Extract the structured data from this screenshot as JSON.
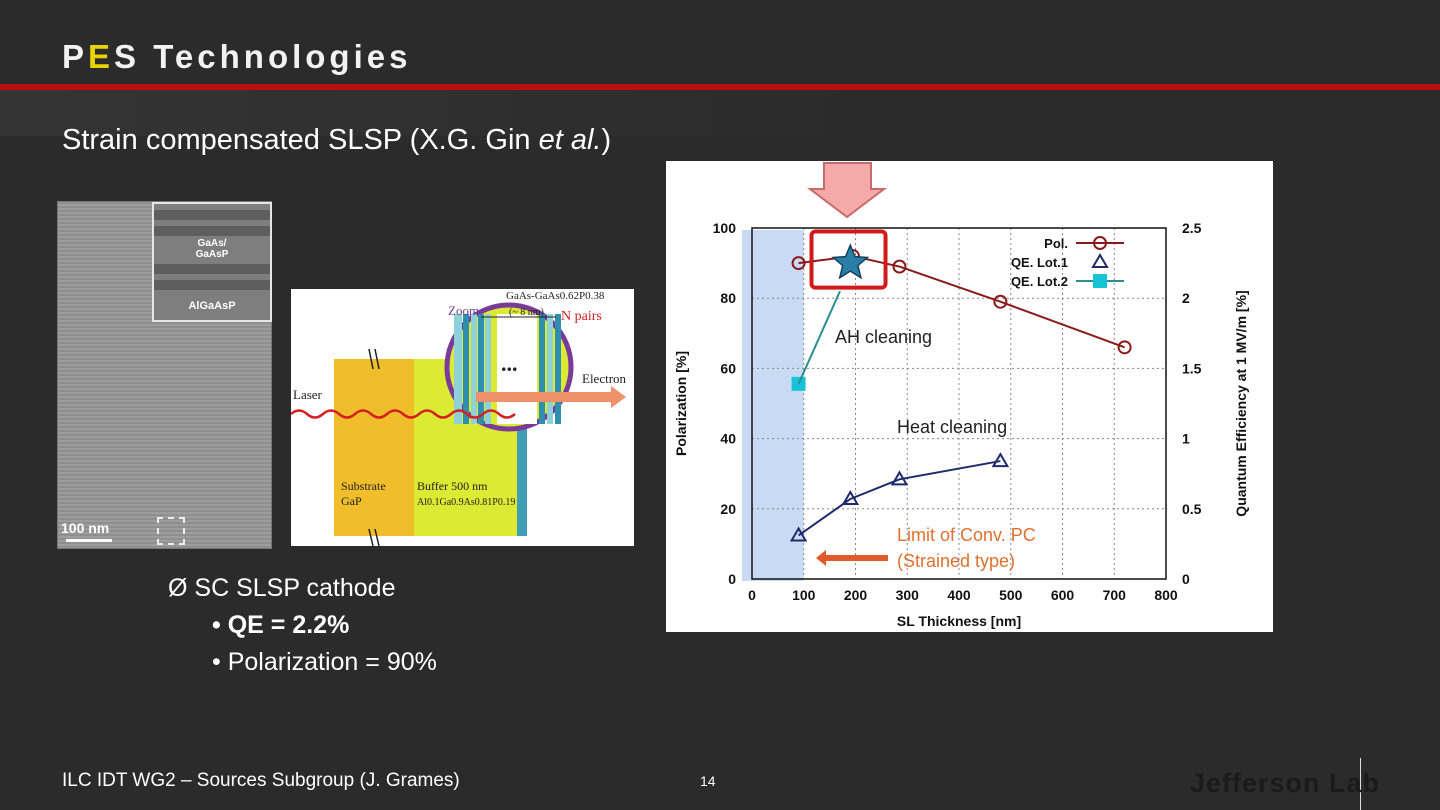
{
  "slide": {
    "title_p": "P",
    "title_e": "E",
    "title_rest": "S Technologies",
    "subtitle_pre": "Strain compensated SLSP (X.G. Gin ",
    "subtitle_em": "et al.",
    "subtitle_post": ")"
  },
  "sem": {
    "inset_top": "GaAs/",
    "inset_top2": "GaAsP",
    "inset_bottom": "AlGaAsP",
    "scale_label": "100 nm"
  },
  "schematic": {
    "zoom": "Zoom",
    "pair_label": "GaAs-GaAs0.62P0.38",
    "pair_thick": "(~ 8 nm)",
    "n_pairs": "N pairs",
    "dots": "...",
    "laser": "Laser",
    "electron": "Electron",
    "substrate": "Substrate",
    "substrate2": "GaP",
    "buffer": "Buffer 500 nm",
    "buffer2": "Al0.1Ga0.9As0.81P0.19"
  },
  "bullets": {
    "main": "SC SLSP cathode",
    "sub1": "QE = 2.2%",
    "sub2": "Polarization = 90%"
  },
  "chart_data": {
    "type": "scatter",
    "xlabel": "SL Thickness [nm]",
    "ylabel": "Polarization [%]",
    "y2label": "Quantum Efficiency at 1 MV/m [%]",
    "xlim": [
      0,
      800
    ],
    "ylim": [
      0,
      100
    ],
    "y2lim": [
      0,
      2.5
    ],
    "x_ticks": [
      "0",
      "100",
      "200",
      "300",
      "400",
      "500",
      "600",
      "700",
      "800"
    ],
    "y_ticks": [
      "0",
      "20",
      "40",
      "60",
      "80",
      "100"
    ],
    "y2_ticks": [
      "0",
      "0.5",
      "1",
      "1.5",
      "2",
      "2.5"
    ],
    "legend": [
      "Pol.",
      "QE. Lot.1",
      "QE. Lot.2"
    ],
    "legend_position": "top-right",
    "grid": true,
    "series": [
      {
        "name": "Pol.",
        "axis": "left",
        "x": [
          90,
          195,
          285,
          480,
          720
        ],
        "y": [
          90,
          92,
          89,
          79,
          66
        ]
      },
      {
        "name": "QE. Lot.1",
        "axis": "right",
        "x": [
          90,
          190,
          285,
          480
        ],
        "y": [
          0.31,
          0.57,
          0.71,
          0.84
        ]
      },
      {
        "name": "QE. Lot.2",
        "axis": "right",
        "x": [
          90
        ],
        "y": [
          1.39
        ]
      }
    ],
    "star": {
      "x": 190,
      "y": 90
    },
    "annotations": [
      "AH cleaning",
      "Heat cleaning",
      "Limit of Conv. PC",
      "(Strained type)"
    ],
    "colors": {
      "pol": "#8b1a1a",
      "lot1": "#1f2a6b",
      "lot2": "#19c3d6",
      "highlight": "#d11a1a",
      "star": "#2a7fa8",
      "arrow": "#e15a2a"
    }
  },
  "footer": {
    "left": "ILC IDT WG2 – Sources Subgroup (J. Grames)",
    "page": "14",
    "logo": "Jefferson Lab"
  }
}
